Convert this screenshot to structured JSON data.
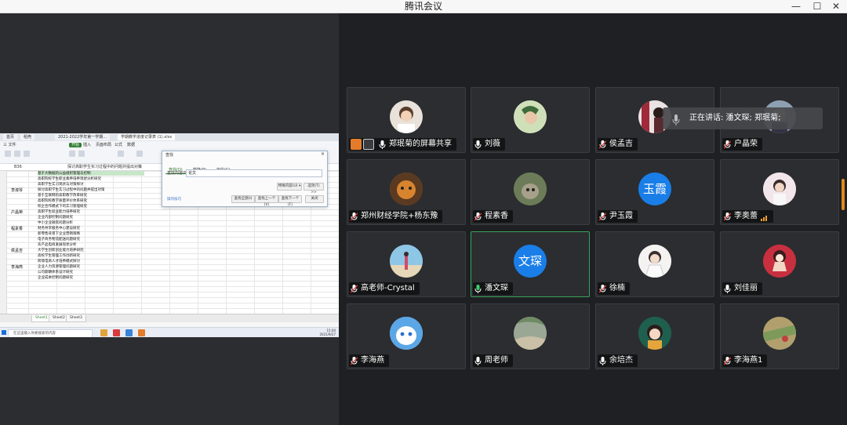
{
  "window": {
    "title": "腾讯会议",
    "minimize": "—",
    "maximize": "☐",
    "close": "✕"
  },
  "speaking_indicator": {
    "text": "正在讲话: 潘文琛; 郑珉菊;"
  },
  "participants": [
    {
      "name": "郑珉菊的屏幕共享",
      "initials": "",
      "avatar_color": "#e8e2da",
      "mic": "on",
      "sharing": true
    },
    {
      "name": "刘薇",
      "initials": "",
      "avatar_color": "#d7e7c4",
      "mic": "on"
    },
    {
      "name": "侯孟吉",
      "initials": "",
      "avatar_color": "#b36a74",
      "mic": "muted"
    },
    {
      "name": "户晶荣",
      "initials": "",
      "avatar_color": "#6f7d8c",
      "mic": "muted"
    },
    {
      "name": "郑州财经学院+杨东豫",
      "initials": "",
      "avatar_color": "#c96a2e",
      "mic": "muted"
    },
    {
      "name": "程素香",
      "initials": "",
      "avatar_color": "#7b8a6a",
      "mic": "muted"
    },
    {
      "name": "尹玉霞",
      "initials": "玉霞",
      "avatar_color": "#1a7ee8",
      "mic": "muted"
    },
    {
      "name": "李奥蕾",
      "initials": "",
      "avatar_color": "#e9d4d9",
      "mic": "muted",
      "signal": true
    },
    {
      "name": "高老师-Crystal",
      "initials": "",
      "avatar_color": "#9bc4da",
      "mic": "muted"
    },
    {
      "name": "潘文琛",
      "initials": "文琛",
      "avatar_color": "#1a7ee8",
      "mic": "on",
      "active": true
    },
    {
      "name": "徐楠",
      "initials": "",
      "avatar_color": "#f0eef0",
      "mic": "muted"
    },
    {
      "name": "刘佳丽",
      "initials": "",
      "avatar_color": "#c23040",
      "mic": "on"
    },
    {
      "name": "李海燕",
      "initials": "",
      "avatar_color": "#d9e3f0",
      "mic": "muted"
    },
    {
      "name": "周老师",
      "initials": "",
      "avatar_color": "#8a9b84",
      "mic": "on"
    },
    {
      "name": "余培杰",
      "initials": "",
      "avatar_color": "#1a6b5a",
      "mic": "on"
    },
    {
      "name": "李海燕1",
      "initials": "",
      "avatar_color": "#a89a6e",
      "mic": "muted"
    }
  ],
  "shared_screen": {
    "app_tabs": [
      "首页",
      "稻壳",
      "2021-2022学年第一学期...",
      "学期教学进度记录表 (1).xlsx"
    ],
    "ribbon_tabs": [
      "三 文件",
      "开始",
      "插入",
      "页面布局",
      "公式",
      "数据",
      "审阅",
      "视图",
      "安全"
    ],
    "cell_ref": "B36",
    "formula_text": "探讨高职学生实习过程中的问题并提出对策",
    "sheet_tabs": [
      "Sheet1",
      "Sheet2",
      "Sheet3"
    ],
    "rows": [
      {
        "label": "",
        "text": "基于大数据的公益组织管理与控制"
      },
      {
        "label": "",
        "text": "高职院校学生职业素养培养现状分析研究"
      },
      {
        "label": "",
        "text": "高职学生实习现状与对策探讨"
      },
      {
        "label": "李淑琴",
        "text": "探讨高职学生实习过程中的问题并提出对策"
      },
      {
        "label": "",
        "text": "基于互联网的高职教学改革研究"
      },
      {
        "label": "",
        "text": "高职院校教学质量评价体系研究"
      },
      {
        "label": "",
        "text": "校企合作模式下的实习管理研究"
      },
      {
        "label": "户晶荣",
        "text": "高职学生就业能力培养研究"
      },
      {
        "label": "",
        "text": "企业内部控制问题研究"
      },
      {
        "label": "",
        "text": "中小企业融资问题分析"
      },
      {
        "label": "程素香",
        "text": "财务共享服务中心建设研究"
      },
      {
        "label": "",
        "text": "新零售背景下企业营销策略"
      },
      {
        "label": "",
        "text": "电子商务物流配送问题研究"
      },
      {
        "label": "",
        "text": "农产品电商发展现状分析"
      },
      {
        "label": "侯孟吉",
        "text": "大学生创新创业能力培养研究"
      },
      {
        "label": "",
        "text": "高校学生管理工作创新研究"
      },
      {
        "label": "",
        "text": "跨境电商人才培养模式探讨"
      },
      {
        "label": "李海燕",
        "text": "企业人力资源管理问题研究"
      },
      {
        "label": "",
        "text": "公司薪酬体系设计研究"
      },
      {
        "label": "",
        "text": "企业成本控制问题研究"
      }
    ],
    "dialog": {
      "title": "查找",
      "tabs": [
        "查找(D)",
        "替换(P)",
        "定位(G)"
      ],
      "find_label": "查找内容(N):",
      "find_value": "论文",
      "special_btn": "特殊内容(U) ▾",
      "options_btn": "选项(T) >>",
      "find_all": "查找全部(I)",
      "find_prev": "查找上一个(V)",
      "find_next": "查找下一个(F)",
      "close_btn": "关闭",
      "tips_link": "操作技巧"
    },
    "taskbar": {
      "search_placeholder": "在这里输入你要搜索的内容",
      "time": "15:00",
      "date": "2021/9/27"
    }
  }
}
